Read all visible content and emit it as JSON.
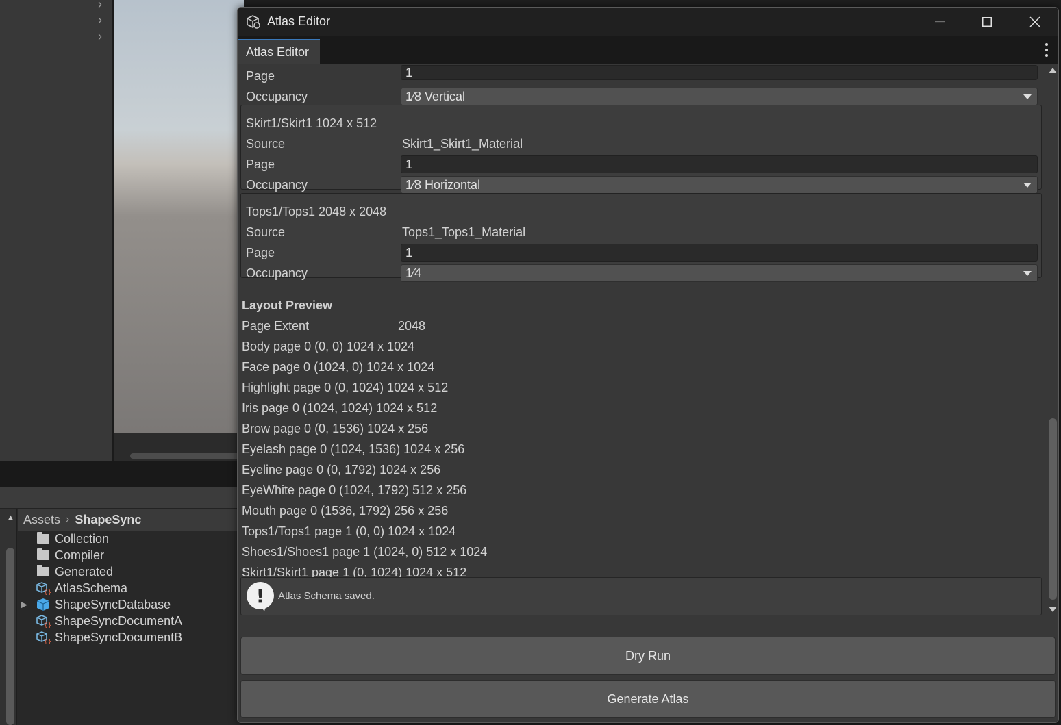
{
  "background": {
    "breadcrumb": {
      "root": "Assets",
      "current": "ShapeSync"
    },
    "assets": [
      {
        "name": "Collection",
        "icon": "folder-icon"
      },
      {
        "name": "Compiler",
        "icon": "folder-icon"
      },
      {
        "name": "Generated",
        "icon": "folder-icon"
      },
      {
        "name": "AtlasSchema",
        "icon": "scriptable-object-icon"
      },
      {
        "name": "ShapeSyncDatabase",
        "icon": "prefab-cube-icon"
      },
      {
        "name": "ShapeSyncDocumentA",
        "icon": "scriptable-object-icon"
      },
      {
        "name": "ShapeSyncDocumentB",
        "icon": "scriptable-object-icon"
      }
    ]
  },
  "window": {
    "title": "Atlas Editor",
    "tab_label": "Atlas Editor",
    "accent_color": "#3a79bb"
  },
  "entries": {
    "partial": {
      "page_label": "Page",
      "page_value": "1",
      "occupancy_label": "Occupancy",
      "occupancy_value": "1⁄8 Vertical"
    },
    "skirt": {
      "header": "Skirt1/Skirt1  1024 x 512",
      "source_label": "Source",
      "source_value": "Skirt1_Skirt1_Material",
      "page_label": "Page",
      "page_value": "1",
      "occupancy_label": "Occupancy",
      "occupancy_value": "1⁄8 Horizontal"
    },
    "tops": {
      "header": "Tops1/Tops1  2048 x 2048",
      "source_label": "Source",
      "source_value": "Tops1_Tops1_Material",
      "page_label": "Page",
      "page_value": "1",
      "occupancy_label": "Occupancy",
      "occupancy_value": "1⁄4"
    }
  },
  "preview": {
    "title": "Layout Preview",
    "page_extent_label": "Page Extent",
    "page_extent_value": "2048",
    "lines": [
      "Body  page 0  (0, 0) 1024 x 1024",
      "Face  page 0  (1024, 0) 1024 x 1024",
      "Highlight  page 0  (0, 1024) 1024 x 512",
      "Iris  page 0  (1024, 1024) 1024 x 512",
      "Brow  page 0  (0, 1536) 1024 x 256",
      "Eyelash  page 0  (1024, 1536) 1024 x 256",
      "Eyeline  page 0  (0, 1792) 1024 x 256",
      "EyeWhite  page 0  (1024, 1792) 512 x 256",
      "Mouth  page 0  (1536, 1792) 256 x 256",
      "Tops1/Tops1  page 1  (0, 0) 1024 x 1024",
      "Shoes1/Shoes1  page 1  (1024, 0) 512 x 1024",
      "Skirt1/Skirt1  page 1  (0, 1024) 1024 x 512"
    ]
  },
  "notice": {
    "text": "Atlas Schema saved.",
    "icon": "info-bubble-icon"
  },
  "buttons": {
    "dry_run": "Dry Run",
    "generate": "Generate Atlas"
  }
}
